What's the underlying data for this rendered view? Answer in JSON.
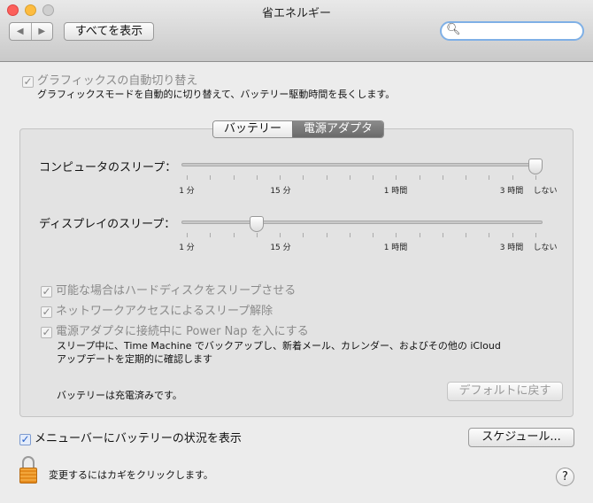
{
  "window": {
    "title": "省エネルギー"
  },
  "toolbar": {
    "back": "◀",
    "forward": "▶",
    "show_all": "すべてを表示",
    "search_placeholder": "",
    "search_icon": "magnifier-icon"
  },
  "graphics": {
    "label": "グラフィックスの自動切り替え",
    "checked": true,
    "description": "グラフィックスモードを自動的に切り替えて、バッテリー駆動時間を長くします。"
  },
  "tabs": [
    {
      "label": "バッテリー",
      "selected": false
    },
    {
      "label": "電源アダプタ",
      "selected": true
    }
  ],
  "sliders": {
    "tick_labels": [
      "1 分",
      "15 分",
      "1 時間",
      "3 時間",
      "しない"
    ],
    "computer": {
      "label": "コンピュータのスリープ：",
      "value": "しない",
      "position": 1.0
    },
    "display": {
      "label": "ディスプレイのスリープ：",
      "value": "10 分",
      "position": 0.2
    }
  },
  "options": [
    {
      "label": "可能な場合はハードディスクをスリープさせる",
      "checked": true
    },
    {
      "label": "ネットワークアクセスによるスリープ解除",
      "checked": true
    },
    {
      "label": "電源アダプタに接続中に Power Nap を入にする",
      "checked": true
    }
  ],
  "power_nap_desc": [
    "スリープ中に、Time Machine でバックアップし、新着メール、カレンダー、およびその他の iCloud",
    "アップデートを定期的に確認します"
  ],
  "battery_status": "バッテリーは充電済みです。",
  "default_button": "デフォルトに戻す",
  "menubar_option": {
    "label": "メニューバーにバッテリーの状況を表示",
    "checked": true
  },
  "schedule_button": "スケジュール...",
  "lock_text": "変更するにはカギをクリックします。",
  "help": "?",
  "colors": {
    "close": "#fc605b",
    "minimize": "#fdbc40",
    "zoom": "#c8c8c8",
    "check_blue": "#2a62c9"
  }
}
